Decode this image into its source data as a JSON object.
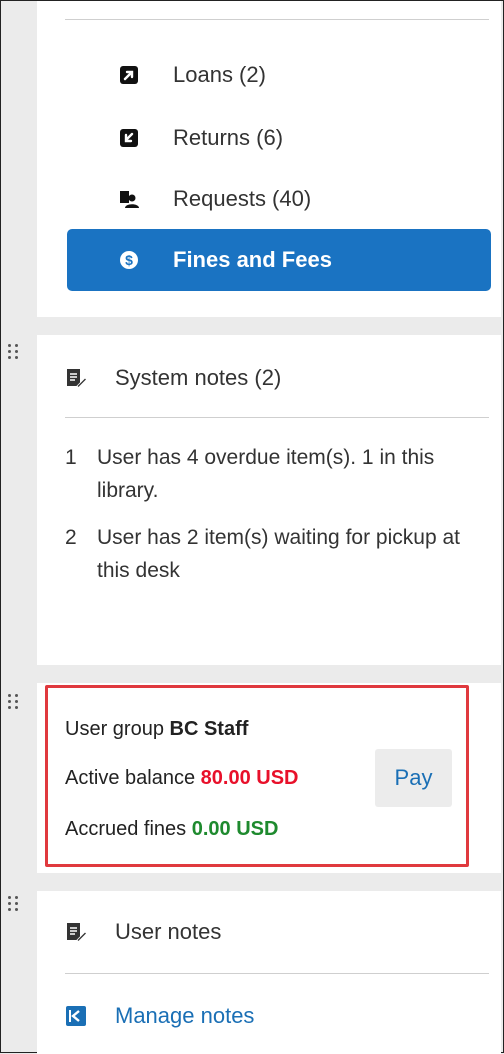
{
  "nav": {
    "items": [
      {
        "label": "Loans (2)",
        "icon": "loan-out-arrow-icon"
      },
      {
        "label": "Returns (6)",
        "icon": "return-in-arrow-icon"
      },
      {
        "label": "Requests (40)",
        "icon": "requests-people-icon"
      },
      {
        "label": "Fines and Fees",
        "icon": "dollar-circle-icon",
        "active": true
      }
    ]
  },
  "system_notes": {
    "title": "System notes (2)",
    "items": [
      {
        "num": "1",
        "text": "User has 4 overdue item(s). 1 in this library."
      },
      {
        "num": "2",
        "text": "User has 2 item(s) waiting for pickup at this desk"
      }
    ]
  },
  "user_info": {
    "group_label": "User group",
    "group_value": "BC Staff",
    "balance_label": "Active balance",
    "balance_value": "80.00 USD",
    "balance_color": "#e8102a",
    "accrued_label": "Accrued fines",
    "accrued_value": "0.00 USD",
    "accrued_color": "#1e8a2e",
    "pay_label": "Pay"
  },
  "user_notes": {
    "title": "User notes",
    "manage_label": "Manage notes"
  },
  "colors": {
    "accent": "#1a73c2",
    "link": "#1a6fb5",
    "highlight_border": "#e0393e"
  }
}
